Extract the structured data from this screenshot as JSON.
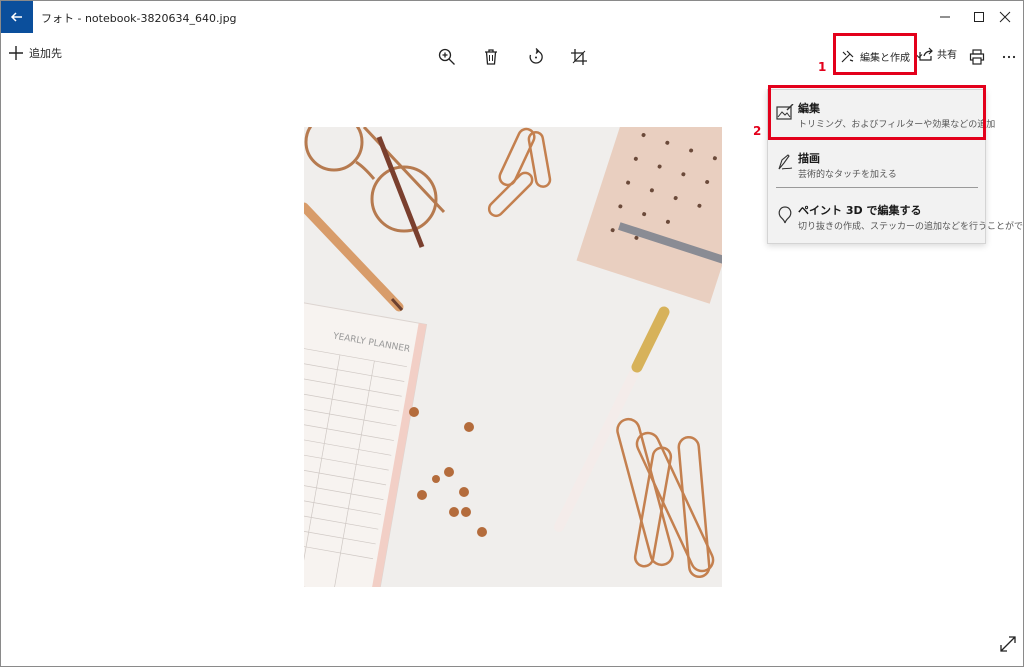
{
  "window": {
    "title": "フォト - notebook-3820634_640.jpg",
    "controls": [
      "minimize",
      "maximize",
      "close"
    ]
  },
  "toolbar": {
    "add_label": "追加先",
    "zoom_icon": "zoom-in-icon",
    "delete_icon": "trash-icon",
    "rotate_icon": "rotate-icon",
    "crop_icon": "crop-icon",
    "edit_create_label": "編集と作成",
    "share_label": "共有",
    "print_icon": "print-icon",
    "more_icon": "more-icon"
  },
  "annotations": {
    "step1": "1",
    "step2": "2",
    "highlight_color": "#e3001b"
  },
  "menu": {
    "items": [
      {
        "title": "編集",
        "desc": "トリミング、およびフィルターや効果などの追加",
        "icon": "image-edit-icon"
      },
      {
        "title": "描画",
        "desc": "芸術的なタッチを加える",
        "icon": "pen-draw-icon"
      },
      {
        "title": "ペイント 3D で編集する",
        "desc": "切り抜きの作成、ステッカーの追加などを行うことができます",
        "icon": "paint3d-icon"
      }
    ]
  },
  "colors": {
    "accent": "#0b4f9c",
    "menu_bg": "#f2f2f2"
  }
}
